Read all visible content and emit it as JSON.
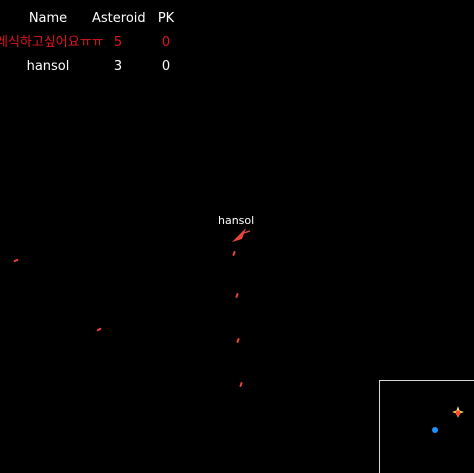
{
  "scoreboard": {
    "headers": {
      "name": "Name",
      "asteroid": "Asteroid",
      "pk": "PK"
    },
    "rows": [
      {
        "name": "레식하고싶어요ㅠㅠ",
        "asteroid": "5",
        "pk": "0",
        "color": "#e0141e"
      },
      {
        "name": "hansol",
        "asteroid": "3",
        "pk": "0",
        "color": "#ffffff"
      }
    ]
  },
  "player": {
    "name": "hansol",
    "ship_color": "#e8453c"
  },
  "bullet_color": "#e8453c",
  "minimap": {
    "border_color": "#d9d9d9",
    "player_dot_color": "#1e90ff",
    "other_dot_color": "#ff6a3d"
  }
}
